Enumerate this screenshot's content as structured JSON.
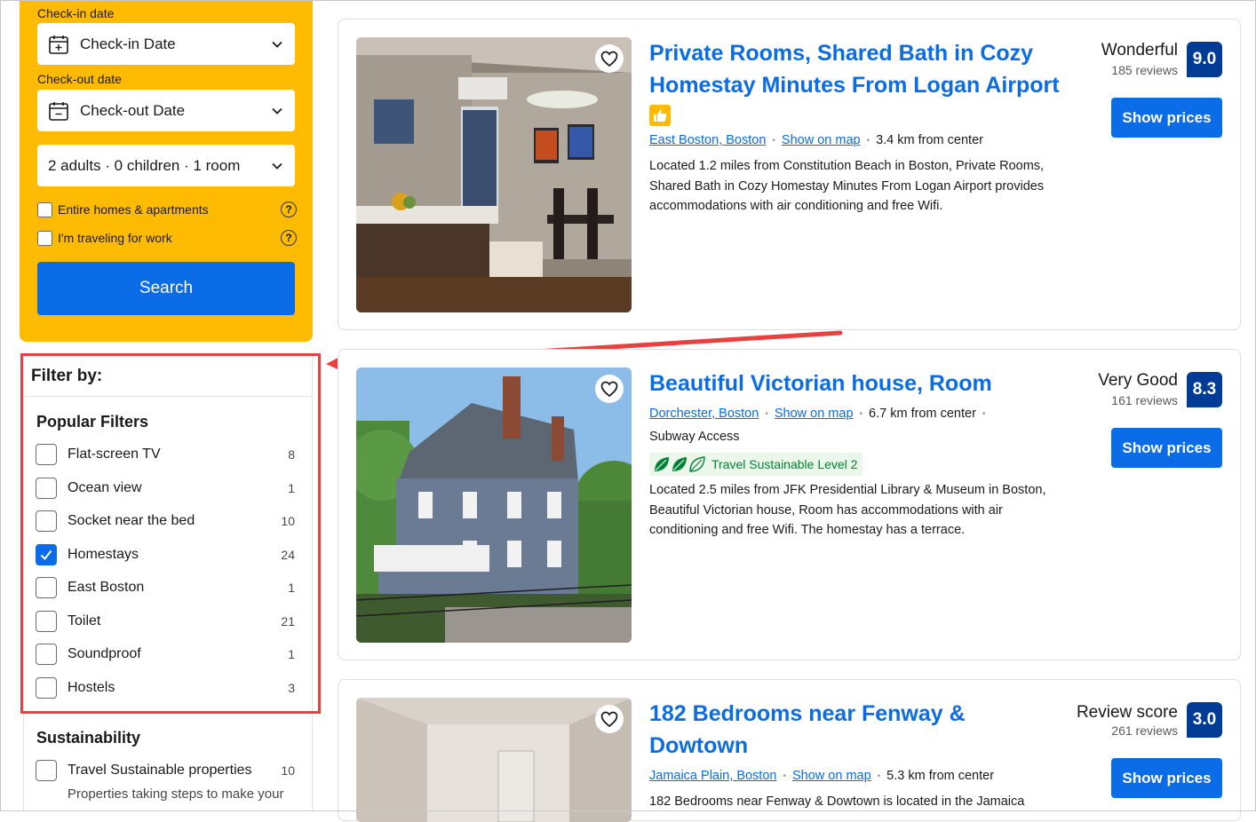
{
  "search": {
    "checkin_label": "Check-in date",
    "checkin_value": "Check-in Date",
    "checkout_label": "Check-out date",
    "checkout_value": "Check-out Date",
    "guests_value": "2 adults · 0 children · 1 room",
    "entire_homes_label": "Entire homes & apartments",
    "work_travel_label": "I'm traveling for work",
    "search_button": "Search"
  },
  "filters": {
    "title": "Filter by:",
    "popular_title": "Popular Filters",
    "popular": [
      {
        "label": "Flat-screen TV",
        "count": "8",
        "checked": false
      },
      {
        "label": "Ocean view",
        "count": "1",
        "checked": false
      },
      {
        "label": "Socket near the bed",
        "count": "10",
        "checked": false
      },
      {
        "label": "Homestays",
        "count": "24",
        "checked": true
      },
      {
        "label": "East Boston",
        "count": "1",
        "checked": false
      },
      {
        "label": "Toilet",
        "count": "21",
        "checked": false
      },
      {
        "label": "Soundproof",
        "count": "1",
        "checked": false
      },
      {
        "label": "Hostels",
        "count": "3",
        "checked": false
      }
    ],
    "sustainability_title": "Sustainability",
    "sustainability": [
      {
        "label": "Travel Sustainable properties",
        "count": "10",
        "checked": false,
        "sub": "Properties taking steps to make your"
      }
    ]
  },
  "results": [
    {
      "title": "Private Rooms, Shared Bath in Cozy Homestay Minutes From Logan Airport",
      "area": "East Boston, Boston",
      "map_link": "Show on map",
      "distance": "3.4 km from center",
      "description": "Located 1.2 miles from Constitution Beach in Boston, Private Rooms, Shared Bath in Cozy Homestay Minutes From Logan Airport provides accommodations with air conditioning and free Wifi.",
      "rating_word": "Wonderful",
      "reviews": "185 reviews",
      "score": "9.0",
      "button": "Show prices"
    },
    {
      "title": "Beautiful Victorian house, Room",
      "area": "Dorchester, Boston",
      "map_link": "Show on map",
      "distance": "6.7 km from center",
      "transit": "Subway Access",
      "sustainable": "Travel Sustainable Level 2",
      "description": "Located 2.5 miles from JFK Presidential Library & Museum in Boston, Beautiful Victorian house, Room has accommodations with air conditioning and free Wifi. The homestay has a terrace.",
      "rating_word": "Very Good",
      "reviews": "161 reviews",
      "score": "8.3",
      "button": "Show prices"
    },
    {
      "title": "182 Bedrooms near Fenway & Dowtown",
      "area": "Jamaica Plain, Boston",
      "map_link": "Show on map",
      "distance": "5.3 km from center",
      "description": "182 Bedrooms near Fenway & Dowtown is located in the Jamaica",
      "rating_word": "Review score",
      "reviews": "261 reviews",
      "score": "3.0",
      "button": "Show prices"
    }
  ],
  "colors": {
    "brand_yellow": "#febb02",
    "primary_blue": "#0a6ce6",
    "score_navy": "#003b95",
    "annotation_red": "#e8413f"
  }
}
